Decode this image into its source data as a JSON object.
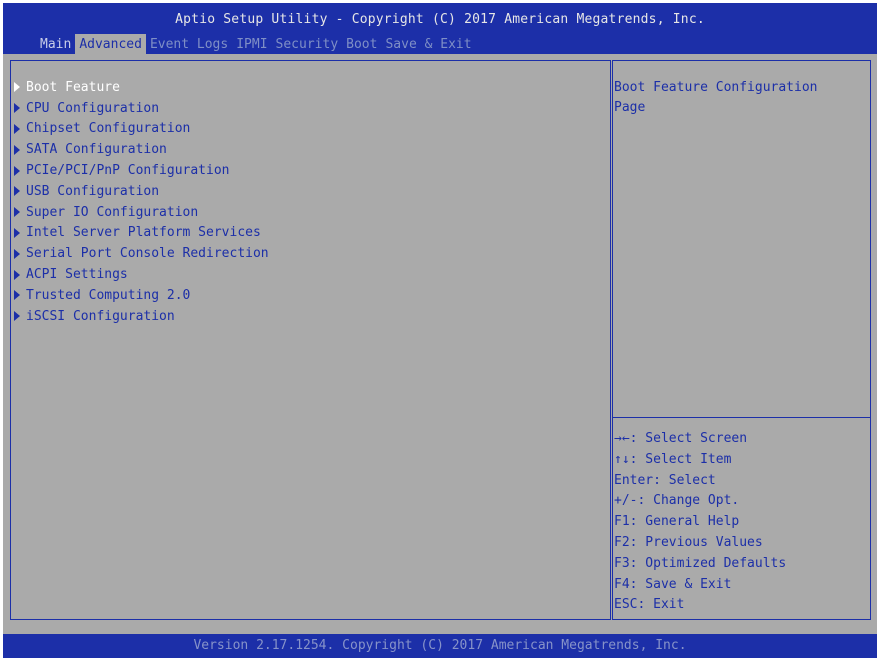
{
  "header": {
    "title": "Aptio Setup Utility - Copyright (C) 2017 American Megatrends, Inc.",
    "tabs": [
      {
        "label": "Main"
      },
      {
        "label": "Advanced"
      },
      {
        "label": "Event Logs"
      },
      {
        "label": "IPMI"
      },
      {
        "label": "Security"
      },
      {
        "label": "Boot"
      },
      {
        "label": "Save & Exit"
      }
    ],
    "active_tab": "Advanced"
  },
  "menu": {
    "items": [
      {
        "label": "Boot Feature"
      },
      {
        "label": "CPU Configuration"
      },
      {
        "label": "Chipset Configuration"
      },
      {
        "label": "SATA Configuration"
      },
      {
        "label": "PCIe/PCI/PnP Configuration"
      },
      {
        "label": "USB Configuration"
      },
      {
        "label": "Super IO Configuration"
      },
      {
        "label": "Intel Server Platform Services"
      },
      {
        "label": "Serial Port Console Redirection"
      },
      {
        "label": "ACPI Settings"
      },
      {
        "label": "Trusted Computing 2.0"
      },
      {
        "label": "iSCSI Configuration"
      }
    ],
    "selected": "Boot Feature"
  },
  "help": {
    "text": "Boot Feature Configuration\nPage"
  },
  "keys": [
    {
      "text": "→←: Select Screen"
    },
    {
      "text": "↑↓: Select Item"
    },
    {
      "text": "Enter: Select"
    },
    {
      "text": "+/-: Change Opt."
    },
    {
      "text": "F1: General Help"
    },
    {
      "text": "F2: Previous Values"
    },
    {
      "text": "F3: Optimized Defaults"
    },
    {
      "text": "F4: Save & Exit"
    },
    {
      "text": "ESC: Exit"
    }
  ],
  "footer": {
    "text": "Version 2.17.1254. Copyright (C) 2017 American Megatrends, Inc."
  },
  "colors": {
    "header_background": "#1c2fa8",
    "screen_background": "#aaaaaa",
    "text": "#1c2fa8",
    "selected_text": "#ffffff"
  }
}
